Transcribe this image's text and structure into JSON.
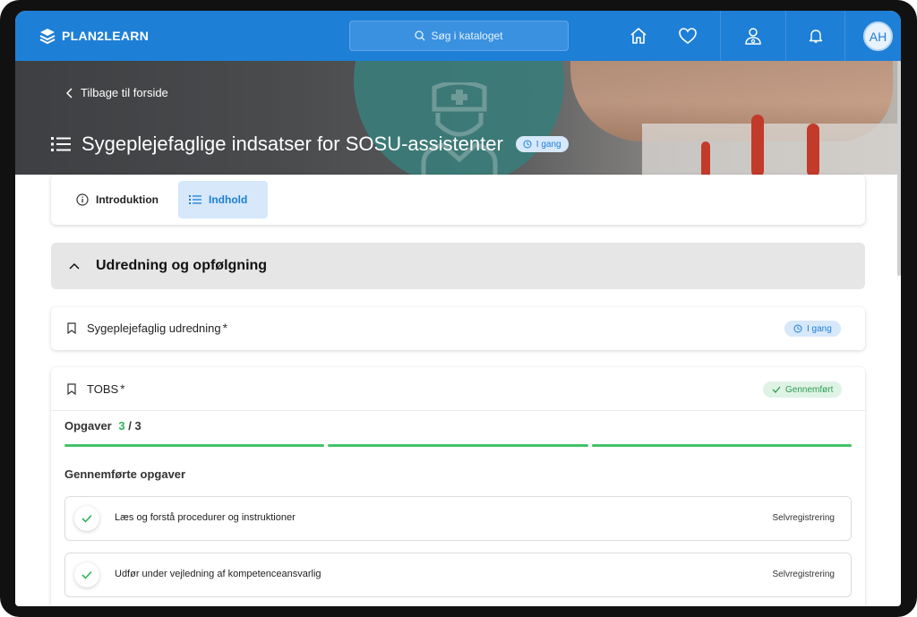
{
  "header": {
    "brand": "PLAN2LEARN",
    "search_placeholder": "Søg i kataloget",
    "avatar_initials": "AH",
    "nav_icons": [
      "home-icon",
      "heart-icon",
      "user-nurse-icon",
      "bell-icon"
    ]
  },
  "hero": {
    "back_label": "Tilbage til forside",
    "title": "Sygeplejefaglige indsatser for SOSU-assistenter",
    "status": "I gang"
  },
  "tabs": [
    {
      "label": "Introduktion",
      "active": false
    },
    {
      "label": "Indhold",
      "active": true
    }
  ],
  "section": {
    "title": "Udredning og opfølgning",
    "expanded": true
  },
  "items": [
    {
      "title": "Sygeplejefaglig udredning",
      "required_mark": "*",
      "status": "I gang"
    },
    {
      "title": "TOBS",
      "required_mark": "*",
      "status": "Gennemført"
    }
  ],
  "tobs": {
    "tasks_label": "Opgaver",
    "tasks_done": "3",
    "tasks_total": "/ 3",
    "progress_segments": 3,
    "progress_filled": 3,
    "completed_title": "Gennemførte opgaver",
    "tasks": [
      {
        "label": "Læs og forstå procedurer og instruktioner",
        "type": "Selvregistrering"
      },
      {
        "label": "Udfør under vejledning af kompetenceansvarlig",
        "type": "Selvregistrering"
      }
    ]
  },
  "colors": {
    "primary": "#1e7fd6",
    "success": "#44c26b",
    "badge_blue_bg": "#d6e8fa",
    "badge_green_bg": "#dff3e5"
  }
}
